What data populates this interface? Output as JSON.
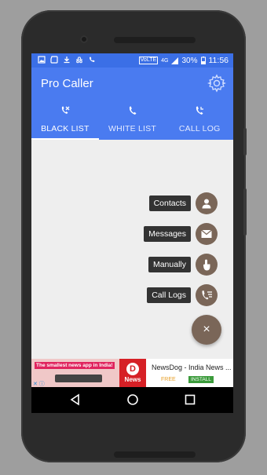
{
  "status_bar": {
    "network_badge": "VoLTE",
    "signal_label": "4G",
    "battery": "30%",
    "time": "11:56"
  },
  "app_bar": {
    "title": "Pro Caller"
  },
  "tabs": [
    {
      "label": "BLACK LIST",
      "icon": "phone-blocked-icon",
      "active": true
    },
    {
      "label": "WHITE LIST",
      "icon": "phone-icon",
      "active": false
    },
    {
      "label": "CALL LOG",
      "icon": "phone-log-icon",
      "active": false
    }
  ],
  "fab_menu": {
    "items": [
      {
        "label": "Contacts",
        "icon": "person-icon"
      },
      {
        "label": "Messages",
        "icon": "envelope-icon"
      },
      {
        "label": "Manually",
        "icon": "hand-pointer-icon"
      },
      {
        "label": "Call Logs",
        "icon": "call-list-icon"
      }
    ],
    "close_symbol": "×"
  },
  "ad": {
    "banner_text": "The smallest news app in India!",
    "logo_text": "News",
    "logo_letter": "D",
    "title": "NewsDog - India News ...",
    "price": "FREE",
    "install_label": "INSTALL"
  },
  "colors": {
    "primary": "#4a7bf0",
    "status_bar": "#3b6fe6",
    "fab": "#7a6658"
  }
}
